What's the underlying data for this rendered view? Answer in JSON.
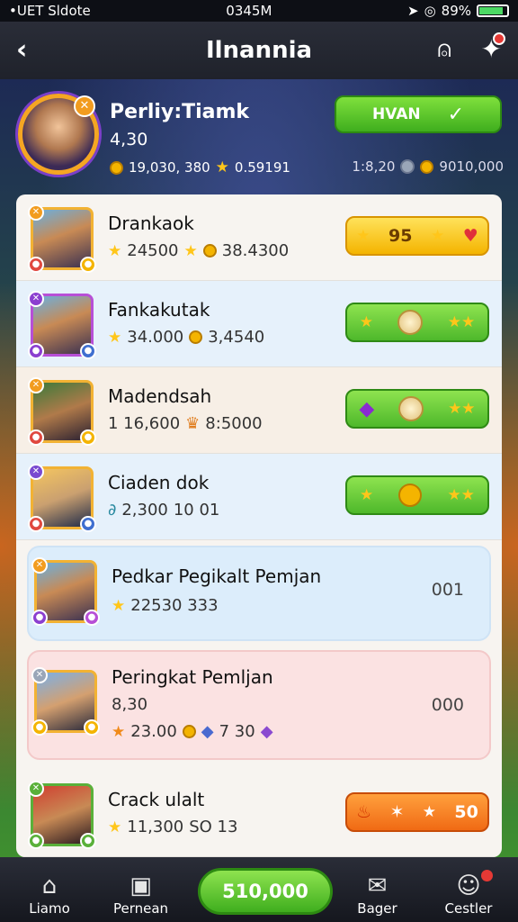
{
  "status": {
    "left": "•UET Sldote",
    "time": "0345M",
    "battery": "89%"
  },
  "header": {
    "title": "Ilnannia"
  },
  "profile": {
    "name": "Perliy:Tiamk",
    "score": "4,30",
    "stat_coins": "19,030, 380",
    "stat_stars": "0.59191",
    "stat_right_a": "1:8,20",
    "stat_right_b": "9010,000",
    "action_label": "HVAN"
  },
  "players": [
    {
      "name": "Drankaok",
      "meta_a": "24500",
      "meta_b": "38.4300",
      "pill_text": "95"
    },
    {
      "name": "Fankakutak",
      "meta_a": "34.000",
      "meta_b": "3,4540"
    },
    {
      "name": "Madendsah",
      "meta_a": "1 16,600",
      "meta_b": "8:5000"
    },
    {
      "name": "Ciaden dok",
      "meta_a": "2,300",
      "meta_b": "10 01"
    },
    {
      "name": "Pedkar Pegikalt Pemjan",
      "meta_a": "22530 333",
      "value": "001"
    },
    {
      "name": "Peringkat Pemljan",
      "meta_sub": "8,30",
      "meta_a": "23.00",
      "meta_b": "7 30",
      "value": "000"
    },
    {
      "name": "Crack ulalt",
      "meta_a": "11,300",
      "meta_b": "SO 13",
      "pill_text": "50"
    }
  ],
  "nav": {
    "home": "Liamo",
    "pemean": "Pernean",
    "center": "510,000",
    "bager": "Bager",
    "cestler": "Cestler"
  }
}
